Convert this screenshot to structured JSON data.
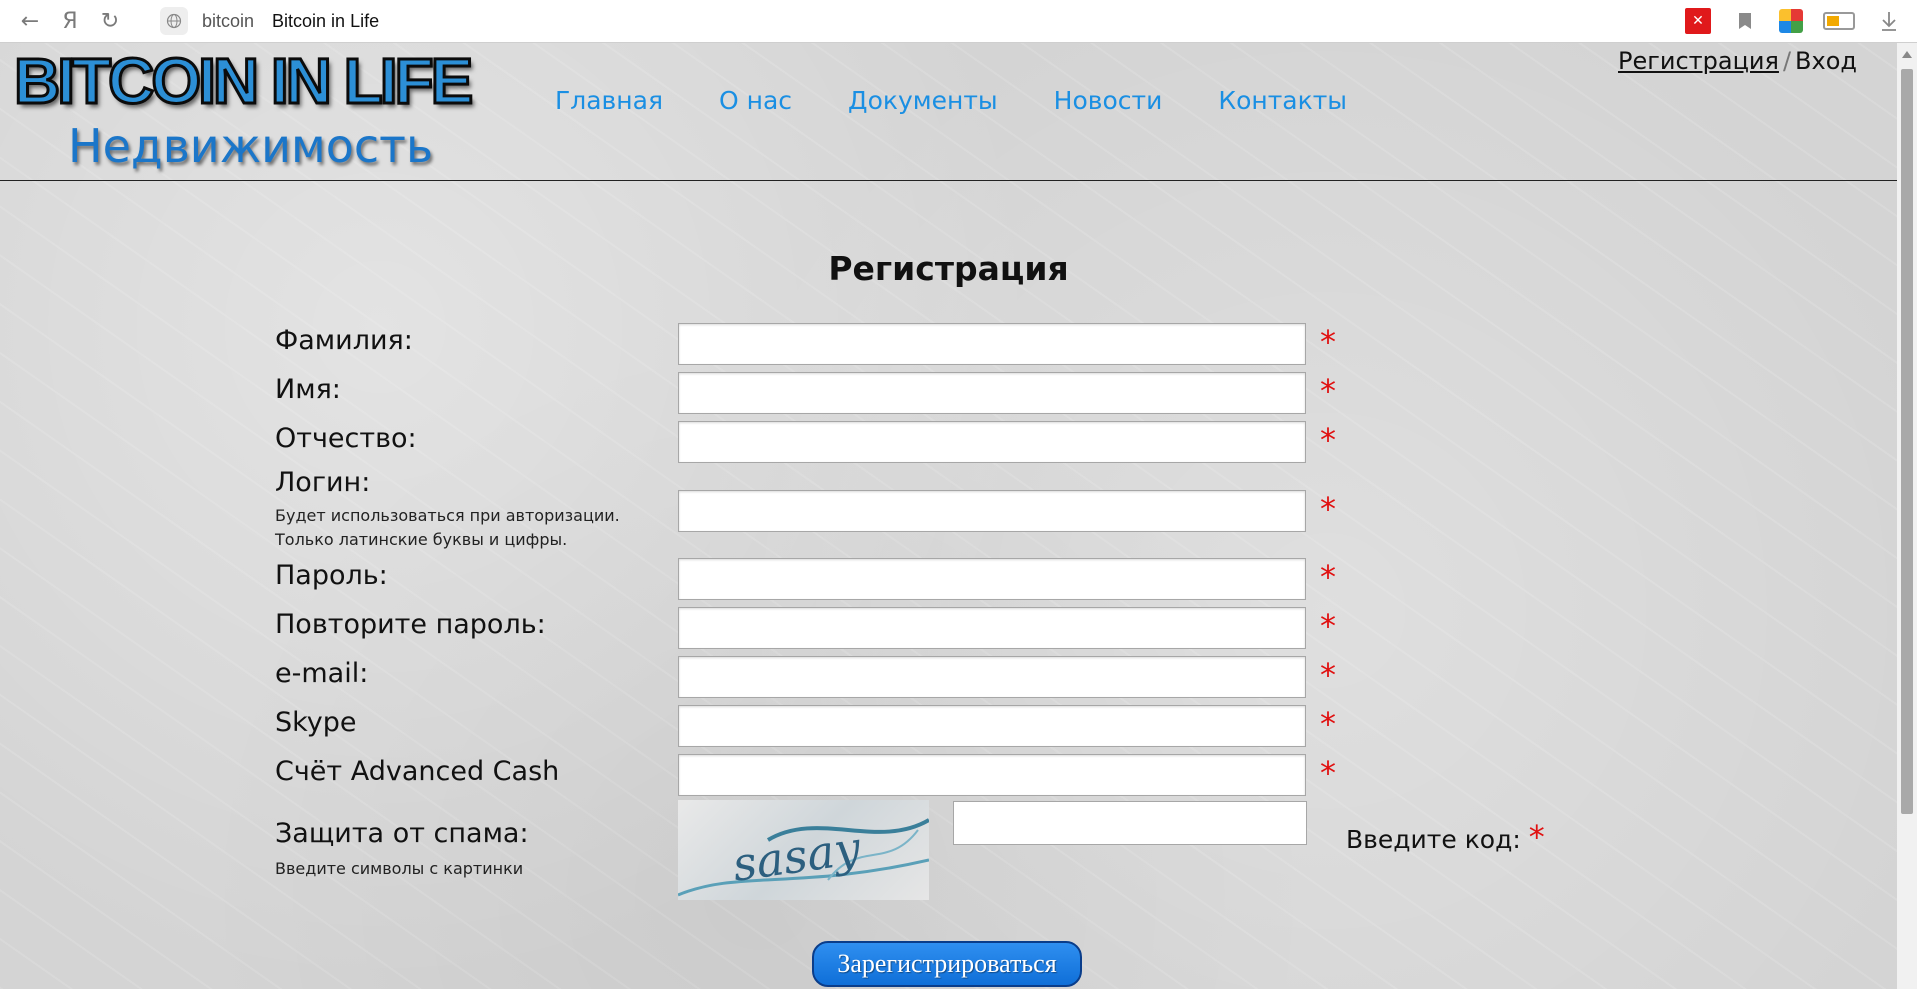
{
  "browser": {
    "back_icon": "←",
    "yandex_icon": "Я",
    "reload_icon": "↻",
    "site_icon": "globe-icon",
    "domain": "bitcoin",
    "page_title": "Bitcoin in Life",
    "extension_icons": [
      "adblock-icon",
      "bookmark-icon",
      "extensions-icon",
      "battery-icon",
      "download-icon"
    ]
  },
  "header": {
    "logo_main": "BITCOIN IN LIFE",
    "logo_sub": "Недвижимость",
    "nav": [
      "Главная",
      "О нас",
      "Документы",
      "Новости",
      "Контакты"
    ],
    "auth_register": "Регистрация",
    "auth_separator": "/",
    "auth_login": "Вход"
  },
  "form": {
    "title": "Регистрация",
    "fields": {
      "surname": "Фамилия:",
      "name": "Имя:",
      "patronymic": "Отчество:",
      "login": "Логин:",
      "login_hint1": "Будет использоваться при авторизации.",
      "login_hint2": "Только латинские буквы и цифры.",
      "password": "Пароль:",
      "password_repeat": "Повторите пароль:",
      "email": "e-mail:",
      "skype": "Skype",
      "advcash": "Счёт Advanced Cash"
    },
    "required_mark": "*",
    "spam_label": "Защита от спама:",
    "spam_hint": "Введите символы с картинки",
    "captcha_text": "sasay",
    "code_label": "Введите код:",
    "submit_label": "Зарегистрироваться"
  },
  "colors": {
    "nav_link": "#1a8fe3",
    "required": "#e01010",
    "button": "#1a7fe6"
  }
}
